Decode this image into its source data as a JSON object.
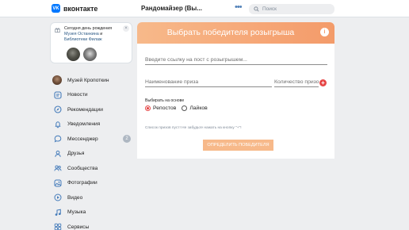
{
  "header": {
    "logo_mark": "VK",
    "logo_text": "вконтакте",
    "app_title": "Рандомайзер (Вы...",
    "more_dots": "•••",
    "search_placeholder": "Поиск"
  },
  "birthday": {
    "line1": "Сегодня день рождения",
    "link1": "Музея Останкина",
    "conj": " и ",
    "link2": "Библиотеки Филаж",
    "close": "×"
  },
  "sidebar": {
    "profile_label": "Музей Кропоткин",
    "items": [
      {
        "label": "Новости",
        "icon": "news-icon"
      },
      {
        "label": "Рекомендации",
        "icon": "compass-icon"
      },
      {
        "label": "Уведомления",
        "icon": "bell-icon"
      },
      {
        "label": "Мессенджер",
        "icon": "chat-icon",
        "badge": "2"
      },
      {
        "label": "Друзья",
        "icon": "user-icon"
      },
      {
        "label": "Сообщества",
        "icon": "users-icon"
      },
      {
        "label": "Фотографии",
        "icon": "photo-icon"
      },
      {
        "label": "Видео",
        "icon": "video-icon"
      },
      {
        "label": "Музыка",
        "icon": "music-icon"
      },
      {
        "label": "Сервисы",
        "icon": "services-icon"
      }
    ]
  },
  "app": {
    "banner_title": "Выбрать победителя розыгрыша",
    "info_glyph": "i",
    "link_placeholder": "Введите ссылку на пост с розыгрышем...",
    "prize_placeholder": "Наименование приза",
    "qty_placeholder": "Количество призов",
    "plus_glyph": "+",
    "choose_label": "Выбирать на основе",
    "radio_reposts": "Репостов",
    "radio_likes": "Лайков",
    "empty_note": "Список призов пуст! Не забудьте нажать на кнопку \"+\"!",
    "button_label": "ОПРЕДЕЛИТЬ ПОБЕДИТЕЛЯ"
  },
  "colors": {
    "accent": "#f7b98a",
    "vk_blue": "#0077ff",
    "radio_active": "#e64646"
  }
}
